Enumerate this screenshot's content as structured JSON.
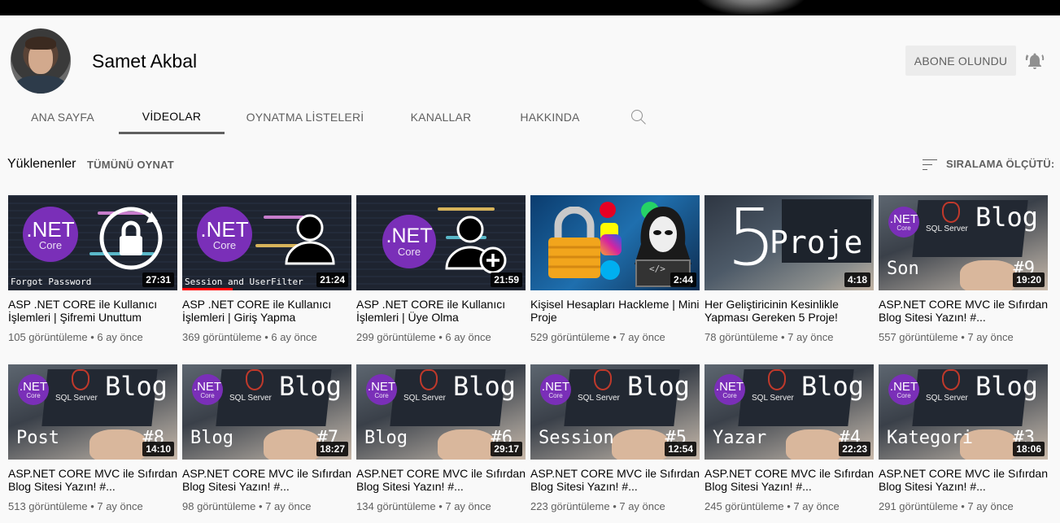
{
  "channel": {
    "name": "Samet Akbal",
    "subscribe_label": "ABONE OLUNDU"
  },
  "tabs": [
    "ANA SAYFA",
    "VİDEOLAR",
    "OYNATMA LİSTELERİ",
    "KANALLAR",
    "HAKKINDA"
  ],
  "active_tab": "VİDEOLAR",
  "section": {
    "title": "Yüklenenler",
    "play_all": "TÜMÜNÜ OYNAT",
    "sort_label": "SIRALAMA ÖLÇÜTÜ:"
  },
  "row1": [
    {
      "title": "ASP .NET CORE ile Kullanıcı İşlemleri | Şifremi Unuttum",
      "duration": "27:31",
      "views": "105 görüntüleme",
      "age": "6 ay önce",
      "thumb_caption": "Forgot Password"
    },
    {
      "title": "ASP .NET CORE ile Kullanıcı İşlemleri | Giriş Yapma",
      "duration": "21:24",
      "views": "369 görüntüleme",
      "age": "6 ay önce",
      "thumb_caption": "Session and UserFilter"
    },
    {
      "title": "ASP .NET CORE ile Kullanıcı İşlemleri | Üye Olma",
      "duration": "21:59",
      "views": "299 görüntüleme",
      "age": "6 ay önce"
    },
    {
      "title": "Kişisel Hesapları Hackleme | Mini Proje",
      "duration": "2:44",
      "views": "529 görüntüleme",
      "age": "7 ay önce"
    },
    {
      "title": "Her Geliştiricinin Kesinlikle Yapması Gereken 5 Proje!",
      "duration": "4:18",
      "views": "78 görüntüleme",
      "age": "7 ay önce",
      "thumb_big": "5",
      "thumb_word": "Proje"
    },
    {
      "title": "ASP.NET CORE MVC ile Sıfırdan Blog Sitesi Yazın! #...",
      "duration": "19:20",
      "views": "557 görüntüleme",
      "age": "7 ay önce",
      "thumb_word": "Son",
      "thumb_num": "#9"
    }
  ],
  "row2": [
    {
      "title": "ASP.NET CORE MVC ile Sıfırdan Blog Sitesi Yazın! #...",
      "duration": "14:10",
      "views": "513 görüntüleme",
      "age": "7 ay önce",
      "thumb_word": "Post",
      "thumb_num": "#8"
    },
    {
      "title": "ASP.NET CORE MVC ile Sıfırdan Blog Sitesi Yazın! #...",
      "duration": "18:27",
      "views": "98 görüntüleme",
      "age": "7 ay önce",
      "thumb_word": "Blog",
      "thumb_num": "#7"
    },
    {
      "title": "ASP.NET CORE MVC ile Sıfırdan Blog Sitesi Yazın! #...",
      "duration": "29:17",
      "views": "134 görüntüleme",
      "age": "7 ay önce",
      "thumb_word": "Blog",
      "thumb_num": "#6"
    },
    {
      "title": "ASP.NET CORE MVC ile Sıfırdan Blog Sitesi Yazın! #...",
      "duration": "12:54",
      "views": "223 görüntüleme",
      "age": "7 ay önce",
      "thumb_word": "Session",
      "thumb_num": "#5"
    },
    {
      "title": "ASP.NET CORE MVC ile Sıfırdan Blog Sitesi Yazın! #...",
      "duration": "22:23",
      "views": "245 görüntüleme",
      "age": "7 ay önce",
      "thumb_word": "Yazar",
      "thumb_num": "#4"
    },
    {
      "title": "ASP.NET CORE MVC ile Sıfırdan Blog Sitesi Yazın! #...",
      "duration": "18:06",
      "views": "291 görüntüleme",
      "age": "7 ay önce",
      "thumb_word": "Kategori",
      "thumb_num": "#3"
    }
  ],
  "thumb_text": {
    "net": ".NET",
    "core": "Core",
    "sql": "SQL Server",
    "blog": "Blog",
    "code_tag": "</>"
  },
  "colors": {
    "net_purple": "#7a2fb8",
    "progress_red": "#ff0000",
    "meta_gray": "#606060"
  },
  "icons": [
    "bell-icon",
    "search-icon",
    "sort-icon",
    "lock-icon",
    "user-icon",
    "user-add-icon",
    "hacker-icon"
  ]
}
